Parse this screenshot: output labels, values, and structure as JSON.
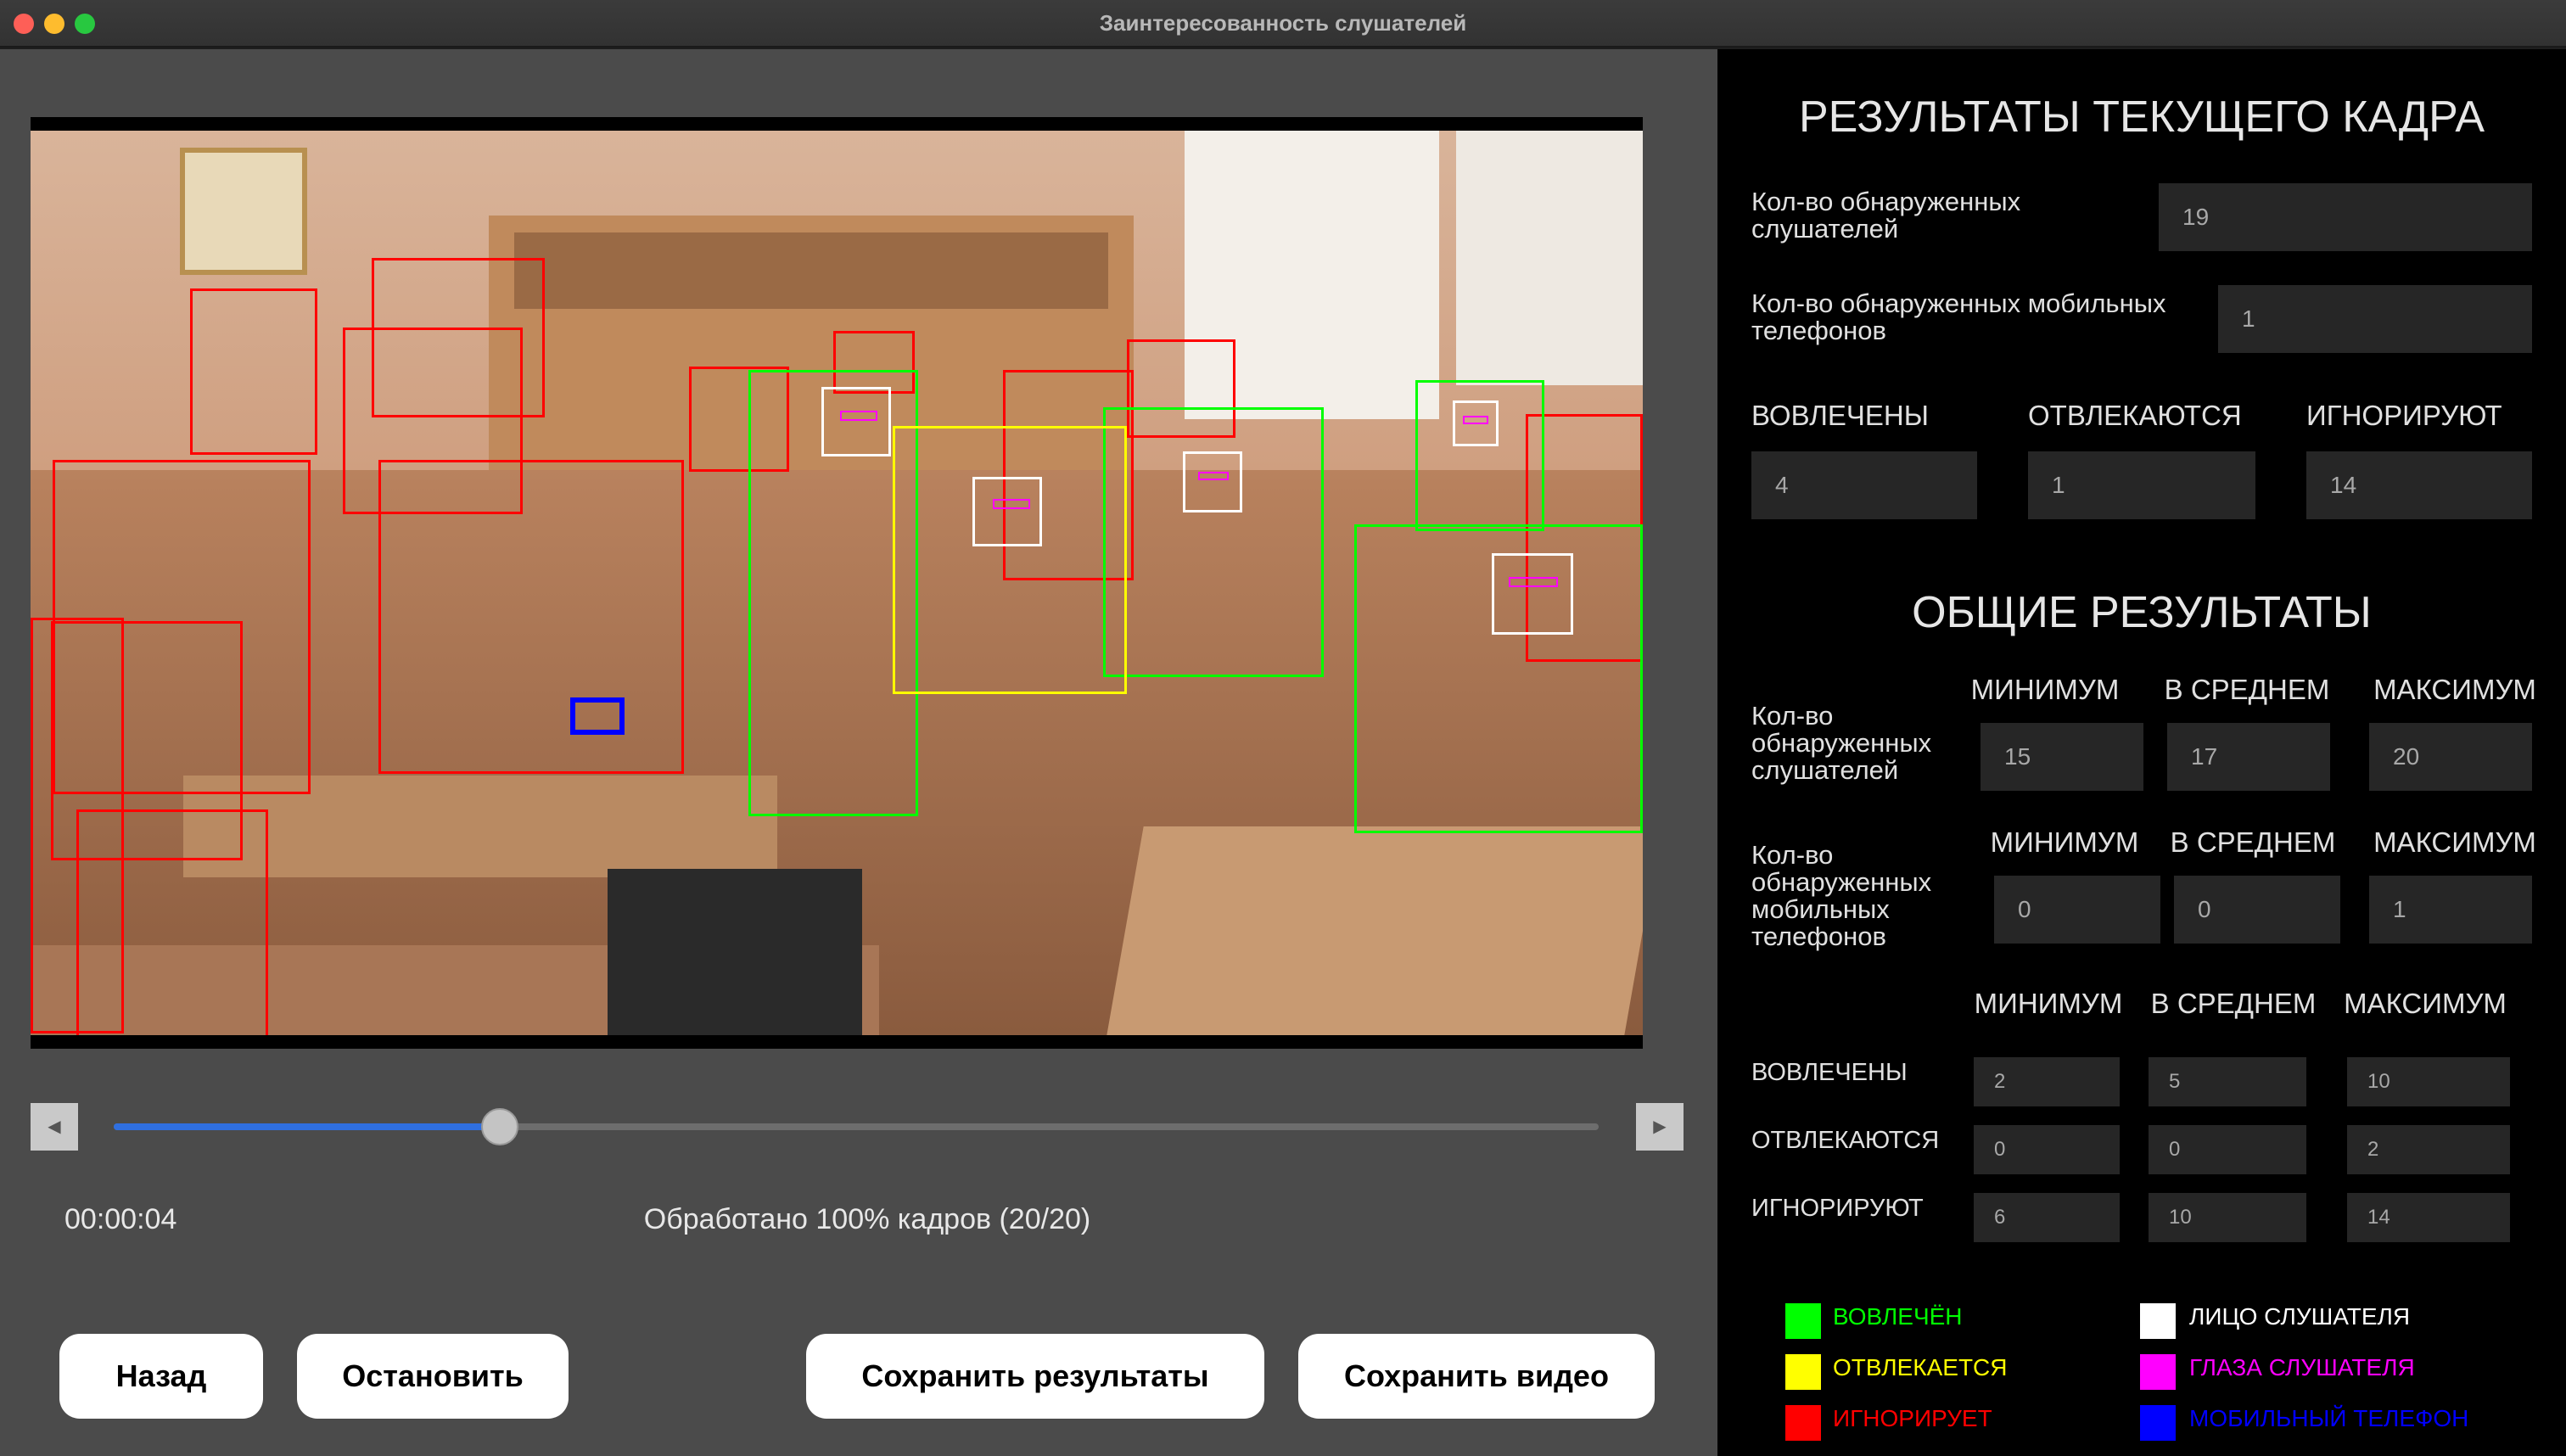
{
  "window": {
    "title": "Заинтересованность слушателей"
  },
  "player": {
    "time": "00:00:04",
    "progress_text": "Обработано 100% кадров (20/20)",
    "position_fraction": 0.26,
    "prev_glyph": "◀",
    "next_glyph": "▶"
  },
  "buttons": {
    "back": "Назад",
    "stop": "Остановить",
    "save_results": "Сохранить результаты",
    "save_video": "Сохранить видео"
  },
  "current": {
    "title": "РЕЗУЛЬТАТЫ ТЕКУЩЕГО КАДРА",
    "listeners_label": "Кол-во обнаруженных слушателей",
    "listeners_value": "19",
    "phones_label": "Кол-во обнаруженных мобильных телефонов",
    "phones_value": "1",
    "engaged_label": "ВОВЛЕЧЕНЫ",
    "engaged_value": "4",
    "distracted_label": "ОТВЛЕКАЮТСЯ",
    "distracted_value": "1",
    "ignoring_label": "ИГНОРИРУЮТ",
    "ignoring_value": "14"
  },
  "overall": {
    "title": "ОБЩИЕ РЕЗУЛЬТАТЫ",
    "min": "МИНИМУМ",
    "avg": "В СРЕДНЕМ",
    "max": "МАКСИМУМ",
    "listeners_label": "Кол-во обнаруженных слушателей",
    "listeners": [
      "15",
      "17",
      "20"
    ],
    "phones_label": "Кол-во обнаруженных мобильных телефонов",
    "phones": [
      "0",
      "0",
      "1"
    ],
    "engaged_label": "ВОВЛЕЧЕНЫ",
    "engaged": [
      "2",
      "5",
      "10"
    ],
    "distracted_label": "ОТВЛЕКАЮТСЯ",
    "distracted": [
      "0",
      "0",
      "2"
    ],
    "ignoring_label": "ИГНОРИРУЮТ",
    "ignoring": [
      "6",
      "10",
      "14"
    ]
  },
  "legend": [
    {
      "label": "ВОВЛЕЧЁН",
      "color": "#00ff00"
    },
    {
      "label": "ОТВЛЕКАЕТСЯ",
      "color": "#ffff00"
    },
    {
      "label": "ИГНОРИРУЕТ",
      "color": "#ff0000"
    },
    {
      "label": "ЛИЦО СЛУШАТЕЛЯ",
      "color": "#ffffff"
    },
    {
      "label": "ГЛАЗА СЛУШАТЕЛЯ",
      "color": "#ff00ff"
    },
    {
      "label": "МОБИЛЬНЫЙ ТЕЛЕФОН",
      "color": "#0000ff"
    }
  ]
}
